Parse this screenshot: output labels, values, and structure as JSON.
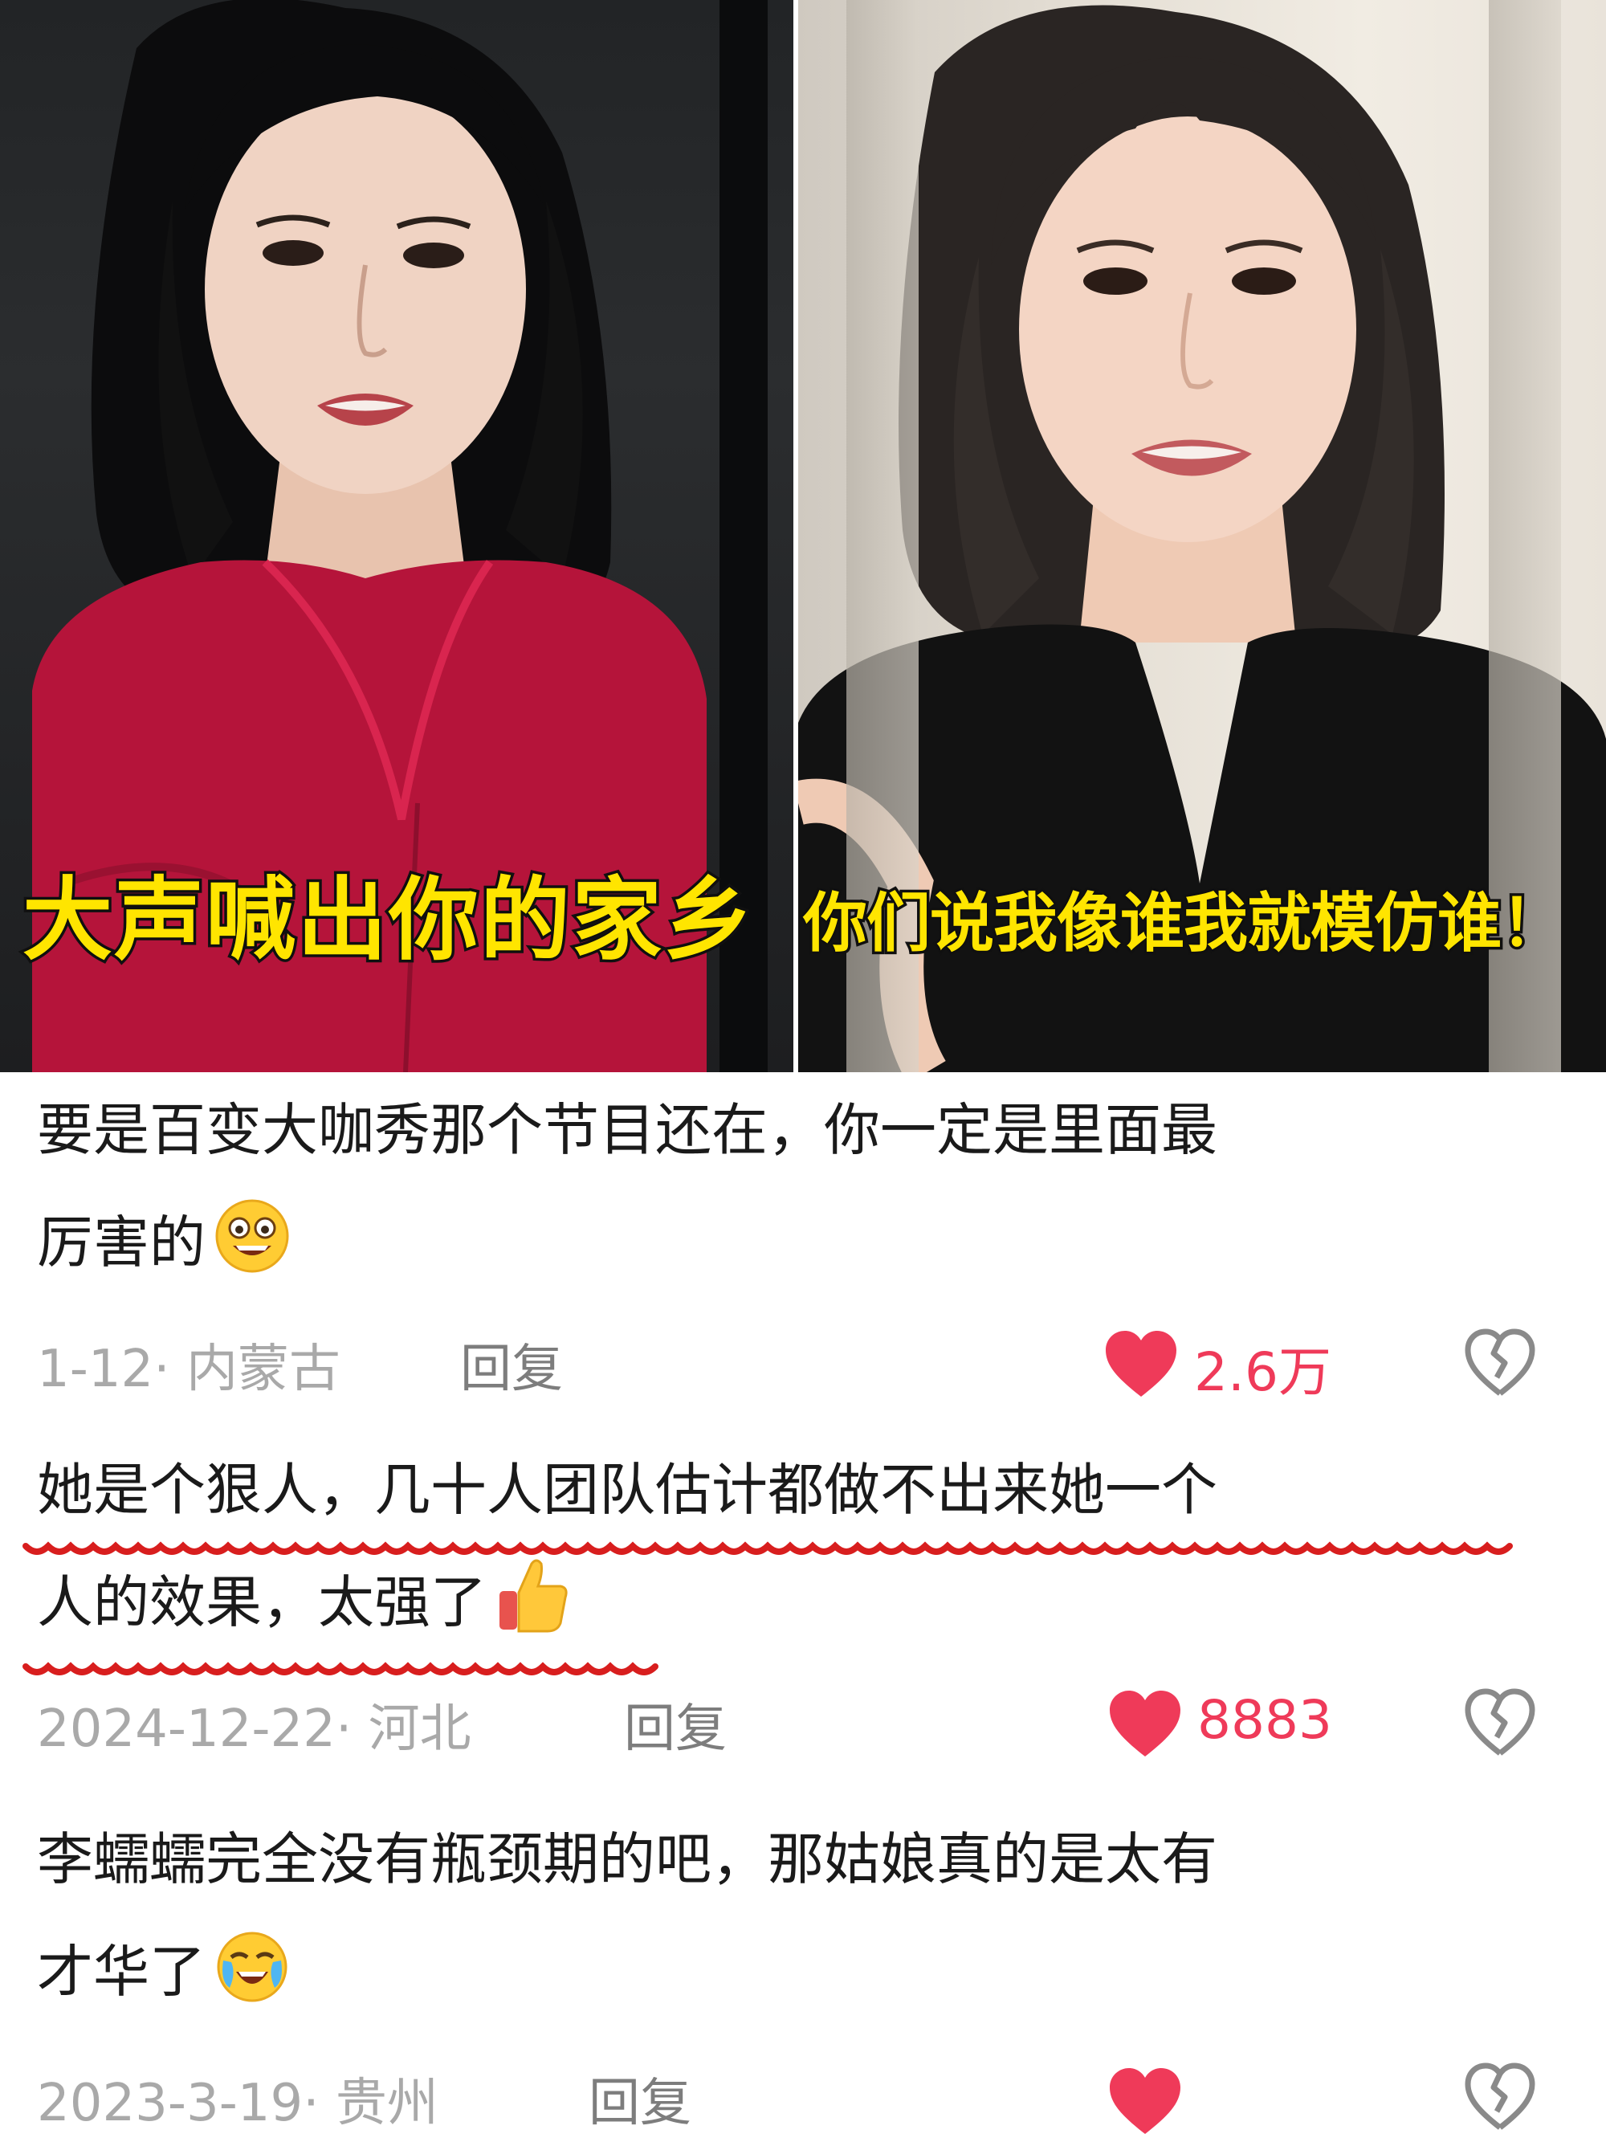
{
  "overlays": {
    "left_caption": "大声喊出你的家乡",
    "right_caption": "你们说我像谁我就模仿谁！"
  },
  "colors": {
    "caption_yellow": "#ffe500",
    "like_red": "#ef3a59",
    "underline_red": "#d81e1e",
    "meta_gray": "#a9a9a9",
    "text_dark": "#1a1a1a"
  },
  "comments": [
    {
      "line1": "要是百变大咖秀那个节目还在，你一定是里面最",
      "line2": "厉害的",
      "emoji": "grinning-face-emoji",
      "date_region": "1-12· 内蒙古",
      "reply": "回复",
      "likes": "2.6万",
      "highlighted": false
    },
    {
      "line1": "她是个狠人，几十人团队估计都做不出来她一个",
      "line2": "人的效果，太强了",
      "emoji": "thumbs-up-emoji",
      "date_region": "2024-12-22· 河北",
      "reply": "回复",
      "likes": "8883",
      "highlighted": true
    },
    {
      "line1": "李蠕蠕完全没有瓶颈期的吧，那姑娘真的是太有",
      "line2": "才华了",
      "emoji": "crying-laughing-emoji",
      "date_region": "2023-3-19· 贵州",
      "reply": "回复",
      "likes": "",
      "highlighted": false
    }
  ]
}
